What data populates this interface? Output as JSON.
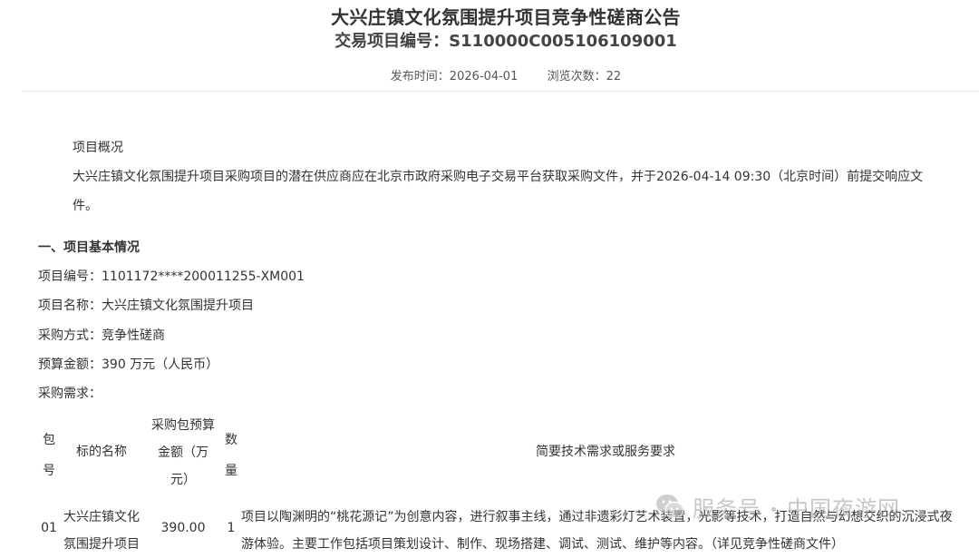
{
  "header": {
    "title": "大兴庄镇文化氛围提升项目竞争性磋商公告",
    "subtitle": "交易项目编号：S110000C005106109001",
    "publish_label": "发布时间：",
    "publish_date": "2026-04-01",
    "views_label": "浏览次数：",
    "views_count": "22"
  },
  "overview": {
    "heading": "项目概况",
    "text_line1": "大兴庄镇文化氛围提升项目采购项目的潜在供应商应在北京市政府采购电子交易平台获取采购文件，并于2026-04-14 09:30（北京时间）前提交响应文",
    "text_line2": "件。"
  },
  "section1": {
    "heading": "一、项目基本情况",
    "project_no": "项目编号：1101172****200011255-XM001",
    "project_name": "项目名称：大兴庄镇文化氛围提升项目",
    "method": "采购方式：竞争性磋商",
    "budget": "预算金额：390 万元（人民币）",
    "demand_label": "采购需求："
  },
  "table": {
    "headers": {
      "pkg_a": "包",
      "pkg_b": "号",
      "name": "标的名称",
      "budget_a": "采购包预算",
      "budget_b": "金额（万",
      "budget_c": "元）",
      "qty_a": "数",
      "qty_b": "量",
      "req": "简要技术需求或服务要求"
    },
    "row": {
      "pkg": "01",
      "name_a": "大兴庄镇文化",
      "name_b": "氛围提升项目",
      "budget": "390.00",
      "qty": "1",
      "req_line1": "项目以陶渊明的“桃花源记”为创意内容，进行叙事主线，通过非遗彩灯艺术装置，光影等技术，打造自然与幻想交织的沉浸式夜",
      "req_line2": "游体验。主要工作包括项目策划设计、制作、现场搭建、调试、测试、维护等内容。（详见竞争性磋商文件）"
    }
  },
  "watermark": {
    "text_left": "服务号",
    "text_right": "中国夜游网"
  }
}
